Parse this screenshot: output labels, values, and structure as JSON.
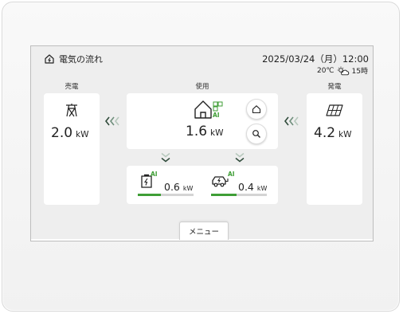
{
  "header": {
    "title": "電気の流れ",
    "datetime": "2025/03/24（月）12:00",
    "temperature": "20℃",
    "weather_time": "15時",
    "home_icon": "home-outline-icon",
    "weather_icon": "sun-cloud-icon"
  },
  "sell": {
    "label": "売電",
    "value": "2.0",
    "unit": "kW",
    "icon": "power-tower-icon"
  },
  "usage": {
    "label": "使用",
    "value": "1.6",
    "unit": "kW",
    "icon": "house-ai-icon",
    "ai_badge": "AI",
    "buttons": [
      {
        "name": "home-mode-button",
        "icon": "house-outline-icon"
      },
      {
        "name": "search-button",
        "icon": "search-icon"
      }
    ]
  },
  "generation": {
    "label": "発電",
    "value": "4.2",
    "unit": "kW",
    "icon": "solar-panel-icon"
  },
  "storage": {
    "battery": {
      "value": "0.6",
      "unit": "kW",
      "ai_badge": "AI",
      "icon": "battery-charging-icon",
      "level": 0.42
    },
    "ev": {
      "value": "0.4",
      "unit": "kW",
      "ai_badge": "AI",
      "icon": "ev-car-icon",
      "level": 0.45
    }
  },
  "footer": {
    "menu_label": "メニュー"
  },
  "colors": {
    "accent": "#3f9e36",
    "arrow_dark": "#2f4a3a",
    "arrow_mid": "#6f8f7c",
    "arrow_light": "#b6c8bc",
    "screen_bg": "#eeeeee",
    "card_bg": "#ffffff"
  }
}
